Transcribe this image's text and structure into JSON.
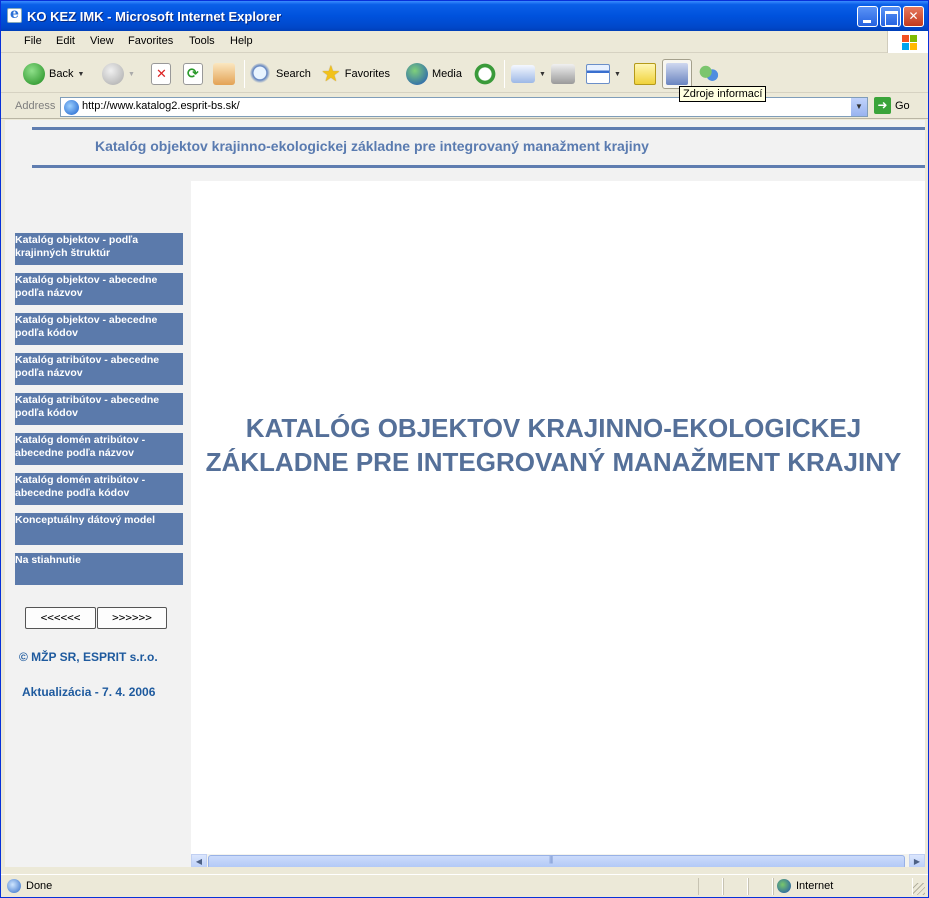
{
  "window": {
    "title": "KO KEZ IMK - Microsoft Internet Explorer"
  },
  "menubar": [
    "File",
    "Edit",
    "View",
    "Favorites",
    "Tools",
    "Help"
  ],
  "toolbar": {
    "back": "Back",
    "search": "Search",
    "favorites": "Favorites",
    "media": "Media",
    "tooltip": "Zdroje informací"
  },
  "address": {
    "label": "Address",
    "url": "http://www.katalog2.esprit-bs.sk/",
    "go": "Go"
  },
  "page": {
    "header_title": "Katalóg objektov krajinno-ekologickej základne pre integrovaný manažment krajiny",
    "main_title": "KATALÓG OBJEKTOV KRAJINNO-EKOLOGICKEJ ZÁKLADNE PRE INTEGROVANÝ MANAŽMENT KRAJINY",
    "nav": [
      "Katalóg objektov  - podľa krajinných štruktúr",
      "Katalóg objektov - abecedne podľa názvov",
      "Katalóg objektov - abecedne podľa kódov",
      "Katalóg atribútov - abecedne podľa názvov",
      "Katalóg atribútov - abecedne podľa kódov",
      "Katalóg domén atribútov - abecedne podľa názvov",
      "Katalóg domén atribútov - abecedne podľa kódov",
      "Konceptuálny dátový model",
      "Na stiahnutie"
    ],
    "prev_button": "<<<<<<",
    "next_button": ">>>>>>",
    "copyright": "© MŽP SR, ESPRIT s.r.o.",
    "updated": "Aktualizácia - 7. 4. 2006"
  },
  "status": {
    "text": "Done",
    "zone": "Internet"
  },
  "colors": {
    "titlebar": "#0052dd",
    "nav_bg": "#5b7aab",
    "header_text": "#5a7bb0",
    "main_title": "#557099",
    "footer_text": "#1e5a9e"
  }
}
